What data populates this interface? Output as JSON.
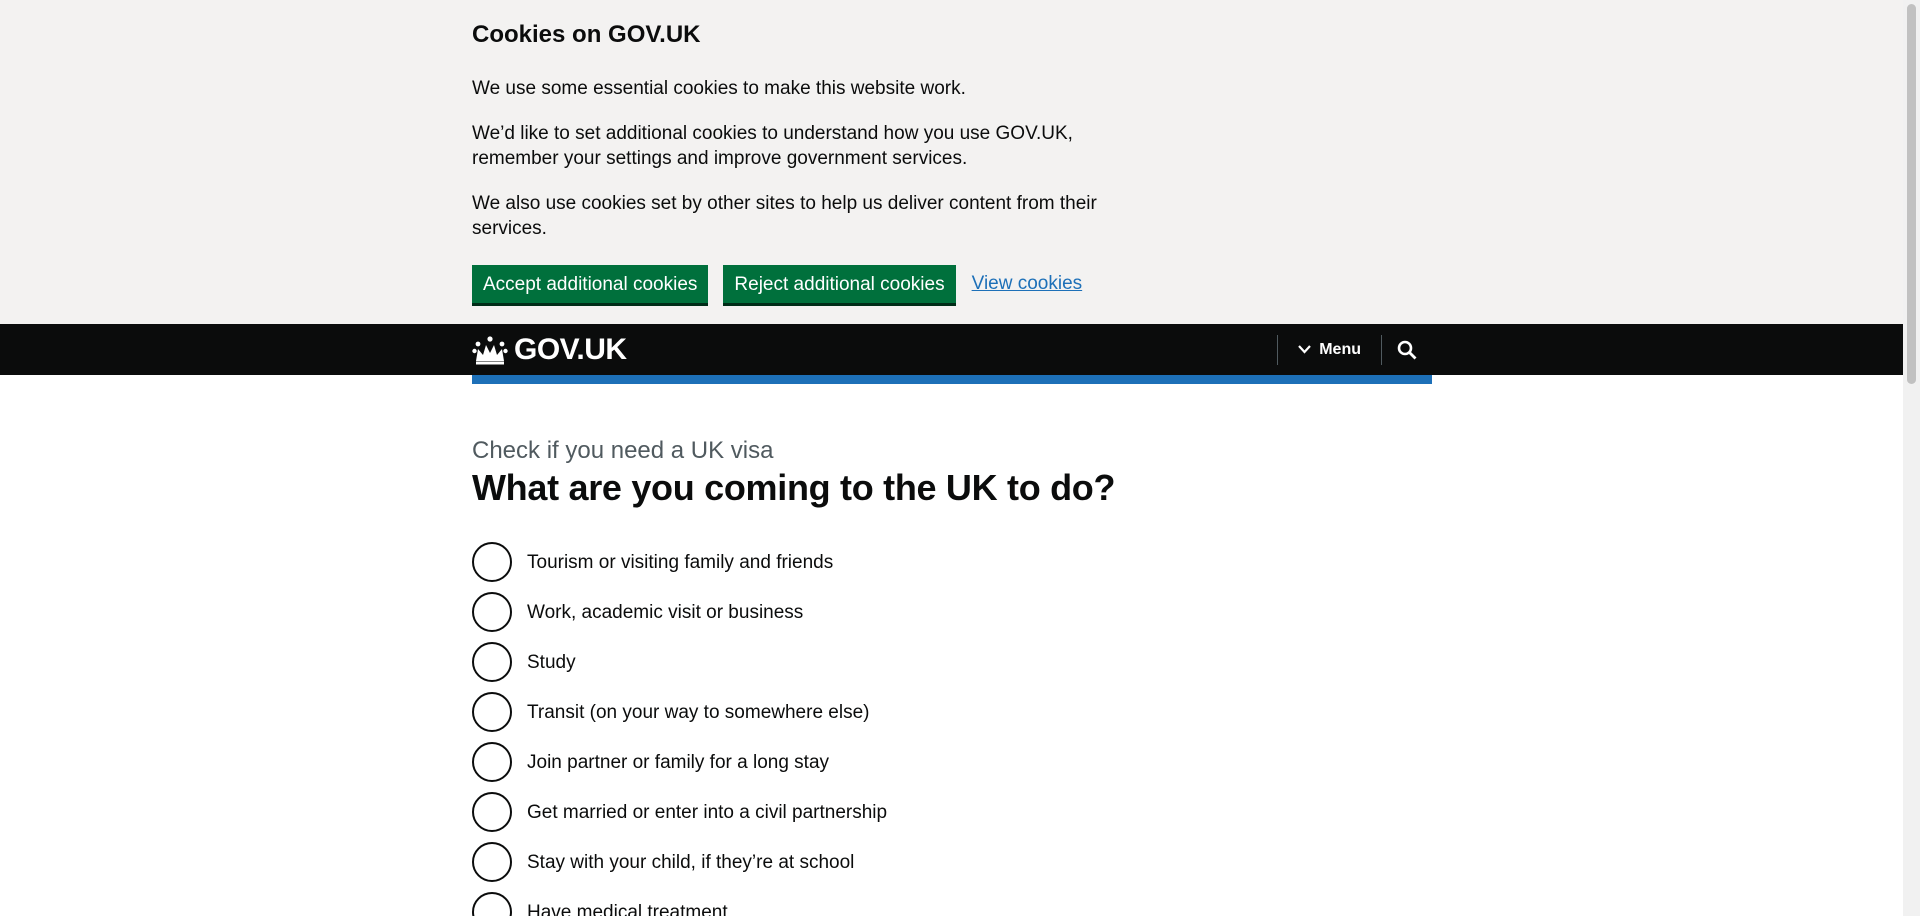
{
  "cookie_banner": {
    "title": "Cookies on GOV.UK",
    "paragraph_1": "We use some essential cookies to make this website work.",
    "paragraph_2": "We’d like to set additional cookies to understand how you use GOV.UK, remember your settings and improve government services.",
    "paragraph_3": "We also use cookies set by other sites to help us deliver content from their services.",
    "accept_label": "Accept additional cookies",
    "reject_label": "Reject additional cookies",
    "view_label": "View cookies"
  },
  "header": {
    "logo_text": "GOV.UK",
    "menu_label": "Menu",
    "icons": [
      "crown-icon",
      "chevron-down-icon",
      "search-icon"
    ]
  },
  "main": {
    "caption": "Check if you need a UK visa",
    "heading": "What are you coming to the UK to do?",
    "options": [
      "Tourism or visiting family and friends",
      "Work, academic visit or business",
      "Study",
      "Transit (on your way to somewhere else)",
      "Join partner or family for a long stay",
      "Get married or enter into a civil partnership",
      "Stay with your child, if they’re at school",
      "Have medical treatment"
    ]
  },
  "colors": {
    "button_green": "#00703c",
    "link_blue": "#1d70b8",
    "header_black": "#0b0c0c",
    "banner_grey": "#f3f2f1"
  }
}
